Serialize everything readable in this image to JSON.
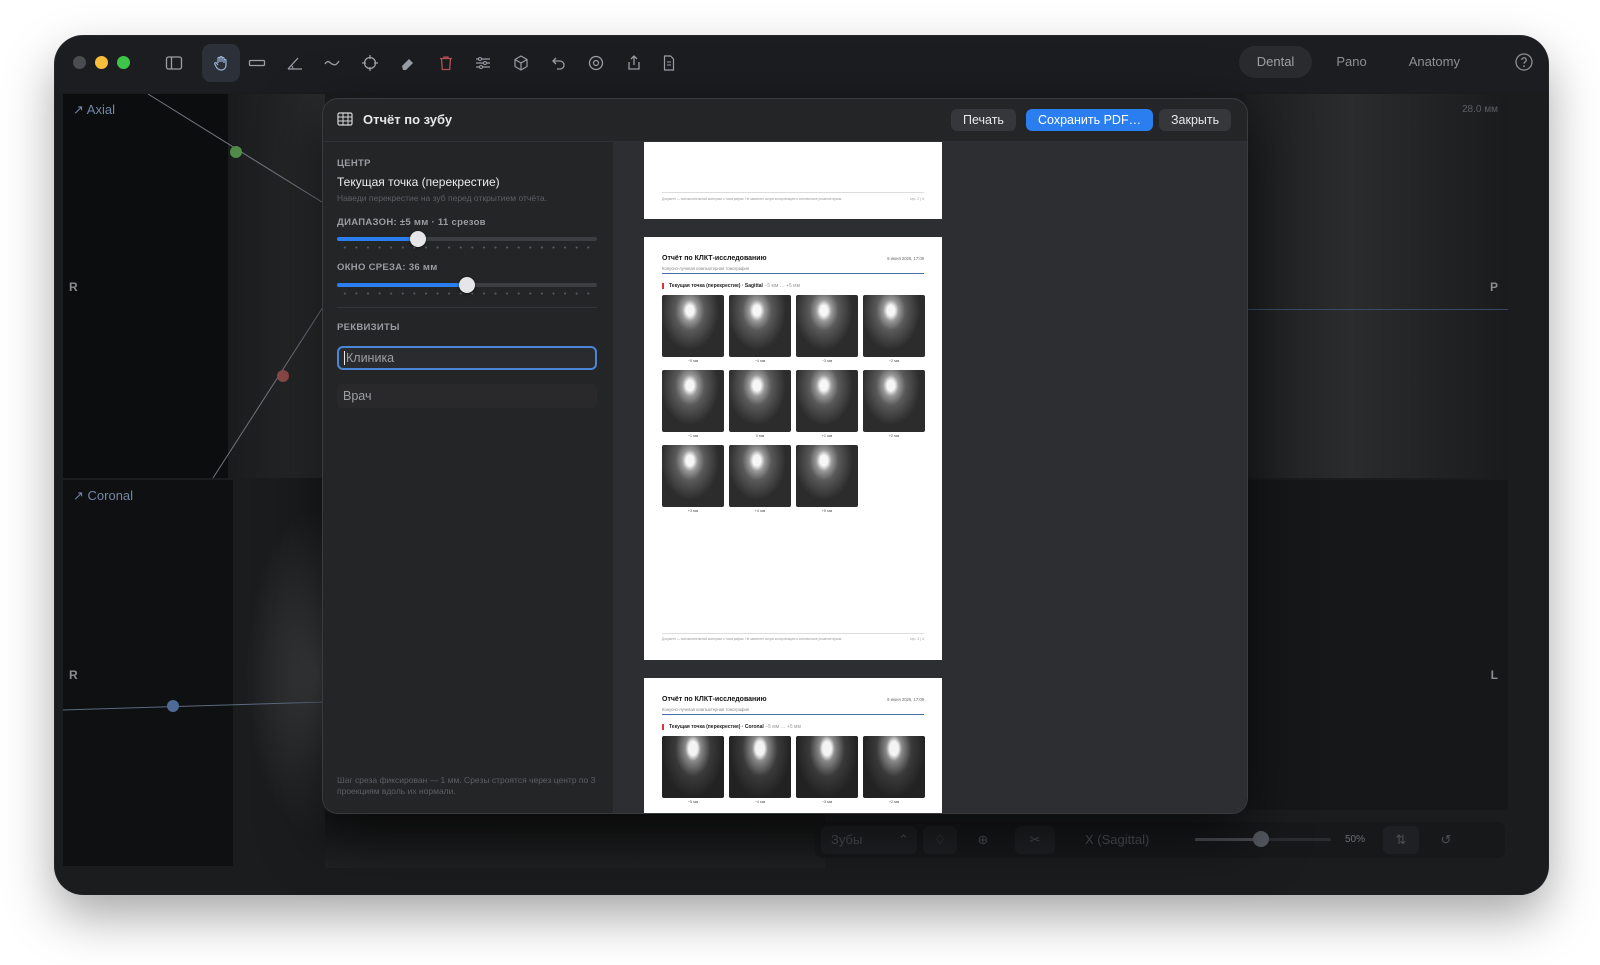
{
  "modes": [
    "Dental",
    "Pano",
    "Anatomy"
  ],
  "toolbar_icons": [
    "sidebar-icon",
    "hand-pan-icon",
    "ruler-icon",
    "angle-icon",
    "curve-icon",
    "crosshair-icon",
    "eraser-icon",
    "trash-icon",
    "sliders-icon",
    "cube-3d-icon",
    "undo-icon",
    "reset-icon",
    "share-icon",
    "report-icon"
  ],
  "viewports": {
    "axial": {
      "label": "Axial",
      "left_mark": "R"
    },
    "coronal": {
      "label": "Coronal",
      "left_mark": "R",
      "right_mark": "L"
    },
    "right_top": {
      "measure": "28.0 мм",
      "right_mark": "P"
    }
  },
  "bottombar": {
    "select": "Зубы",
    "axis": "X (Sagittal)",
    "zoom": "50%"
  },
  "dialog": {
    "title": "Отчёт по зубу",
    "print": "Печать",
    "save_pdf": "Сохранить PDF…",
    "close": "Закрыть",
    "center_label": "ЦЕНТР",
    "center_value": "Текущая точка (перекрестие)",
    "center_hint": "Наведи перекрестие на зуб перед открытием отчёта.",
    "range_label": "ДИАПАЗОН: ±5 мм · 11 срезов",
    "range_value": 0.31,
    "window_label": "ОКНО СРЕЗА: 36 мм",
    "window_value": 0.5,
    "requisites_label": "РЕКВИЗИТЫ",
    "clinic_placeholder": "Клиника",
    "doctor_placeholder": "Врач",
    "footnote": "Шаг среза фиксирован — 1 мм. Срезы строятся через центр по 3 проекциям вдоль их нормали."
  },
  "report": {
    "title": "Отчёт по КЛКТ-исследованию",
    "subtitle": "Конусно-лучевая компьютерная томография",
    "date": "9 июня 2026, 17:09",
    "disclaimer": "Документ — вспомогательный материал к томографии. Не заменяет очную консультацию и клиническое решение врача.",
    "page1_pn": "стр. 2 | 4",
    "page2_pn": "стр. 3 | 4",
    "sagittal_section": "Текущая точка (перекрестие) · Sagittal",
    "coronal_section": "Текущая точка (перекрестие) · Coronal",
    "section_range": "−5 мм … +5 мм",
    "slice_labels": [
      "−5 мм",
      "−4 мм",
      "−3 мм",
      "−2 мм",
      "−1 мм",
      "0 мм",
      "+1 мм",
      "+2 мм",
      "+3 мм",
      "+4 мм",
      "+5 мм"
    ]
  }
}
